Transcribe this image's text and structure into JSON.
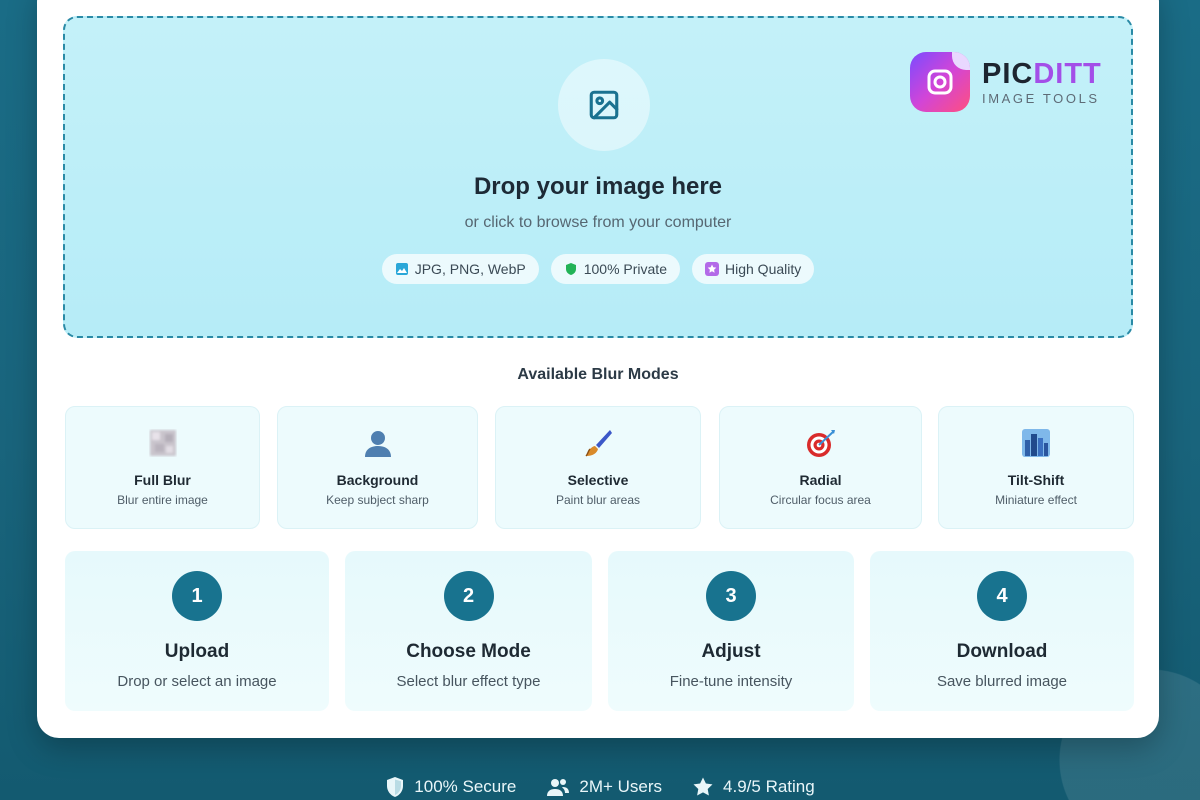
{
  "dropzone": {
    "title": "Drop your image here",
    "subtitle": "or click to browse from your computer",
    "chips": [
      {
        "icon": "image-icon",
        "label": "JPG, PNG, WebP"
      },
      {
        "icon": "shield-icon",
        "label": "100% Private"
      },
      {
        "icon": "star-icon",
        "label": "High Quality"
      }
    ]
  },
  "logo": {
    "name_part1": "PIC",
    "name_part2": "DITT",
    "tagline": "IMAGE TOOLS"
  },
  "blur_modes": {
    "title": "Available Blur Modes",
    "items": [
      {
        "icon": "blur-square-icon",
        "title": "Full Blur",
        "subtitle": "Blur entire image"
      },
      {
        "icon": "person-icon",
        "title": "Background",
        "subtitle": "Keep subject sharp"
      },
      {
        "icon": "paintbrush-icon",
        "title": "Selective",
        "subtitle": "Paint blur areas"
      },
      {
        "icon": "target-icon",
        "title": "Radial",
        "subtitle": "Circular focus area"
      },
      {
        "icon": "cityscape-icon",
        "title": "Tilt-Shift",
        "subtitle": "Miniature effect"
      }
    ]
  },
  "steps": [
    {
      "number": "1",
      "title": "Upload",
      "subtitle": "Drop or select an image"
    },
    {
      "number": "2",
      "title": "Choose Mode",
      "subtitle": "Select blur effect type"
    },
    {
      "number": "3",
      "title": "Adjust",
      "subtitle": "Fine-tune intensity"
    },
    {
      "number": "4",
      "title": "Download",
      "subtitle": "Save blurred image"
    }
  ],
  "footer": [
    {
      "icon": "shield-icon",
      "label": "100% Secure"
    },
    {
      "icon": "users-icon",
      "label": "2M+ Users"
    },
    {
      "icon": "star-icon",
      "label": "4.9/5 Rating"
    }
  ],
  "colors": {
    "accent": "#18738f",
    "dropzone_bg": "#c4f1f9",
    "brand_purple": "#a34ee8"
  }
}
